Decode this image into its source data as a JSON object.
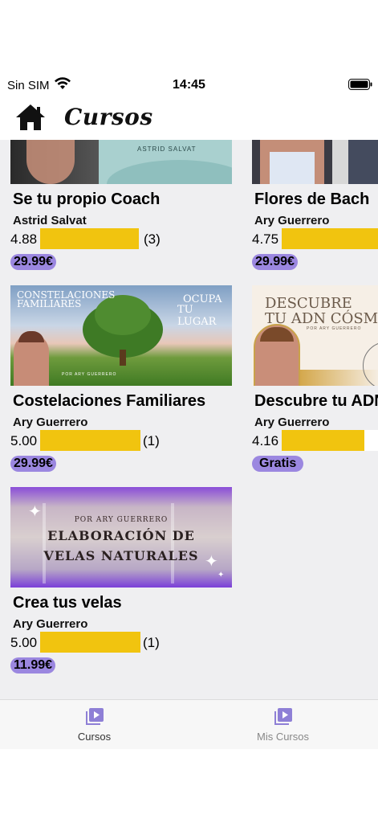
{
  "status_bar": {
    "carrier": "Sin SIM",
    "time": "14:45"
  },
  "nav": {
    "title": "Cursos"
  },
  "courses": [
    {
      "title": "Se tu propio Coach",
      "author": "Astrid Salvat",
      "rating": "4.88",
      "rating_fraction": 0.976,
      "count": "(3)",
      "price": "29.99€",
      "thumb_text": "ASTRID SALVAT"
    },
    {
      "title": "Flores de Bach",
      "author": "Ary Guerrero",
      "rating": "4.75",
      "rating_fraction": 0.95,
      "count": "",
      "price": "29.99€"
    },
    {
      "title": "Costelaciones Familiares",
      "author": "Ary Guerrero",
      "rating": "5.00",
      "rating_fraction": 1.0,
      "count": "(1)",
      "price": "29.99€",
      "thumb_text_1": "CONSTELACIONES",
      "thumb_text_2": "FAMILIARES",
      "thumb_text_3": "OCUPA",
      "thumb_text_4": "TU LUGAR",
      "thumb_text_5": "POR ARY GUERRERO"
    },
    {
      "title": "Descubre tu ADN Cósmico",
      "author": "Ary Guerrero",
      "rating": "4.16",
      "rating_fraction": 0.832,
      "count": "",
      "price": "Gratis",
      "thumb_text_1": "DESCUBRE",
      "thumb_text_2": "TU ADN CÓSMI",
      "thumb_text_3": "POR ARY GUERRERO"
    },
    {
      "title": "Crea tus velas",
      "author": "Ary Guerrero",
      "rating": "5.00",
      "rating_fraction": 1.0,
      "count": "(1)",
      "price": "11.99€",
      "thumb_text_1": "POR ARY GUERRERO",
      "thumb_text_2": "ELABORACIÓN DE",
      "thumb_text_3": "VELAS NATURALES"
    }
  ],
  "tabs": [
    {
      "label": "Cursos",
      "color": "#333333"
    },
    {
      "label": "Mis Cursos",
      "color": "#888888"
    }
  ],
  "colors": {
    "rating_bar": "#f1c40f",
    "price_badge": "#9b87e0",
    "tab_icon": "#8e7fd6"
  }
}
